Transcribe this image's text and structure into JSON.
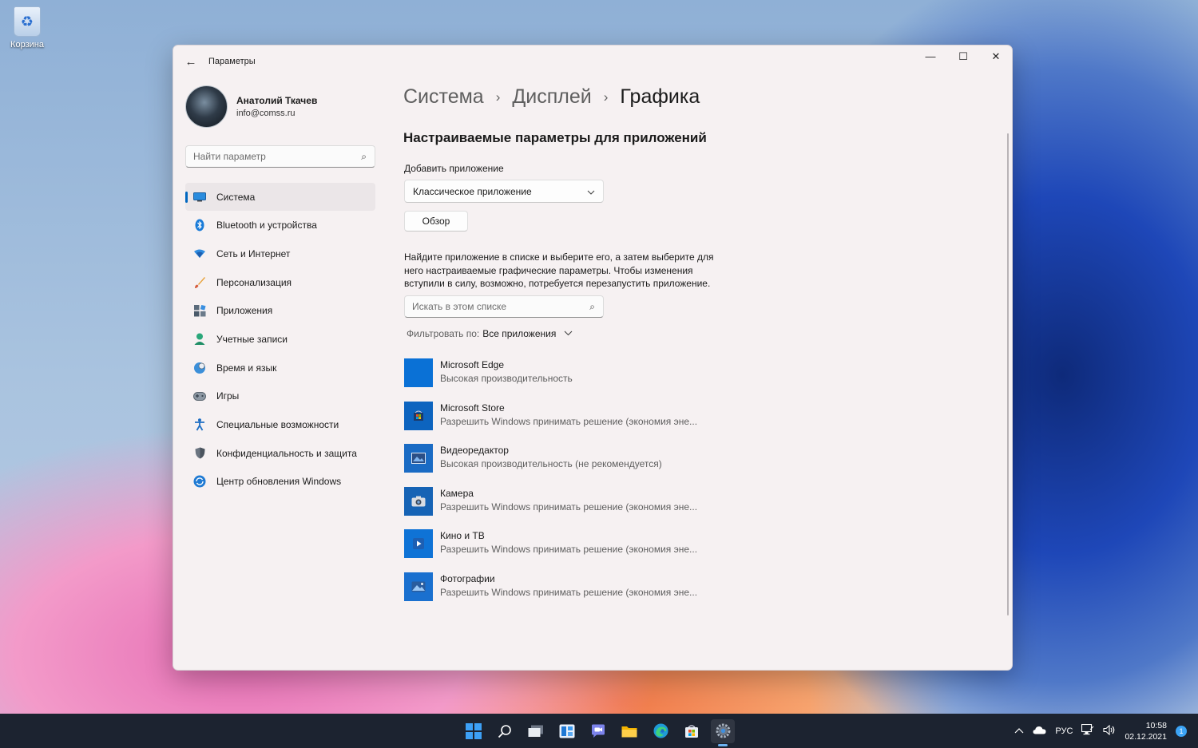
{
  "desktop": {
    "recycle_bin_label": "Корзина"
  },
  "window": {
    "title": "Параметры",
    "controls": {
      "minimize": "—",
      "maximize": "☐",
      "close": "✕"
    }
  },
  "profile": {
    "name": "Анатолий Ткачев",
    "email": "info@comss.ru"
  },
  "sidebar": {
    "search_placeholder": "Найти параметр",
    "items": [
      {
        "label": "Система",
        "icon": "monitor-icon",
        "active": true
      },
      {
        "label": "Bluetooth и устройства",
        "icon": "bluetooth-icon"
      },
      {
        "label": "Сеть и Интернет",
        "icon": "wifi-icon"
      },
      {
        "label": "Персонализация",
        "icon": "brush-icon"
      },
      {
        "label": "Приложения",
        "icon": "apps-icon"
      },
      {
        "label": "Учетные записи",
        "icon": "person-icon"
      },
      {
        "label": "Время и язык",
        "icon": "globe-clock-icon"
      },
      {
        "label": "Игры",
        "icon": "gamepad-icon"
      },
      {
        "label": "Специальные возможности",
        "icon": "accessibility-icon"
      },
      {
        "label": "Конфиденциальность и защита",
        "icon": "shield-icon"
      },
      {
        "label": "Центр обновления Windows",
        "icon": "update-icon"
      }
    ]
  },
  "breadcrumb": {
    "level1": "Система",
    "level2": "Дисплей",
    "level3": "Графика",
    "separator": "›"
  },
  "main": {
    "section_title": "Настраиваемые параметры для приложений",
    "add_app_label": "Добавить приложение",
    "app_type_selected": "Классическое приложение",
    "browse_label": "Обзор",
    "description": "Найдите приложение в списке и выберите его, а затем выберите для него настраиваемые графические параметры. Чтобы изменения вступили в силу, возможно, потребуется перезапустить приложение.",
    "list_search_placeholder": "Искать в этом списке",
    "filter_label": "Фильтровать по:",
    "filter_value": "Все приложения",
    "apps": [
      {
        "name": "Microsoft Edge",
        "preference": "Высокая производительность",
        "icon": "edge-app-icon"
      },
      {
        "name": "Microsoft Store",
        "preference": "Разрешить Windows принимать решение (экономия эне...",
        "icon": "store-app-icon"
      },
      {
        "name": "Видеоредактор",
        "preference": "Высокая производительность (не рекомендуется)",
        "icon": "video-editor-app-icon"
      },
      {
        "name": "Камера",
        "preference": "Разрешить Windows принимать решение (экономия эне...",
        "icon": "camera-app-icon"
      },
      {
        "name": "Кино и ТВ",
        "preference": "Разрешить Windows принимать решение (экономия эне...",
        "icon": "movies-app-icon"
      },
      {
        "name": "Фотографии",
        "preference": "Разрешить Windows принимать решение (экономия эне...",
        "icon": "photos-app-icon"
      }
    ]
  },
  "taskbar": {
    "language": "РУС",
    "time": "10:58",
    "date": "02.12.2021",
    "notifications": "1",
    "accent_color": "#3da0f5"
  }
}
